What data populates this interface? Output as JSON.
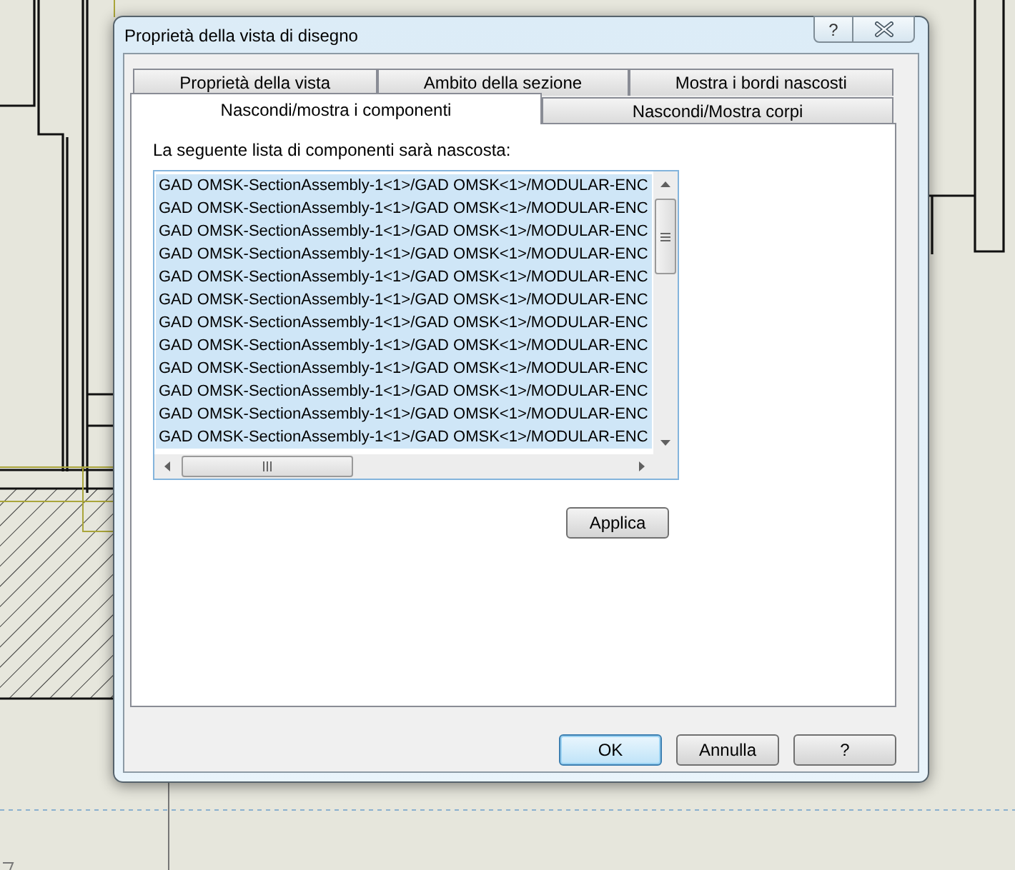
{
  "window": {
    "title": "Proprietà della vista di disegno",
    "help_button": "?"
  },
  "tab_rows": [
    {
      "tabs": [
        {
          "label": "Proprietà della vista",
          "selected": false
        },
        {
          "label": "Ambito della sezione",
          "selected": false
        },
        {
          "label": "Mostra i bordi nascosti",
          "selected": false
        }
      ]
    },
    {
      "tabs": [
        {
          "label": "Nascondi/mostra i componenti",
          "selected": true
        },
        {
          "label": "Nascondi/Mostra corpi",
          "selected": false
        }
      ]
    }
  ],
  "panel": {
    "label": "La seguente lista di componenti sarà nascosta:",
    "list": {
      "items": [
        {
          "text": "GAD OMSK-SectionAssembly-1<1>/GAD OMSK<1>/MODULAR-ENC",
          "selected": true
        },
        {
          "text": "GAD OMSK-SectionAssembly-1<1>/GAD OMSK<1>/MODULAR-ENC",
          "selected": true
        },
        {
          "text": "GAD OMSK-SectionAssembly-1<1>/GAD OMSK<1>/MODULAR-ENC",
          "selected": true
        },
        {
          "text": "GAD OMSK-SectionAssembly-1<1>/GAD OMSK<1>/MODULAR-ENC",
          "selected": true
        },
        {
          "text": "GAD OMSK-SectionAssembly-1<1>/GAD OMSK<1>/MODULAR-ENC",
          "selected": true
        },
        {
          "text": "GAD OMSK-SectionAssembly-1<1>/GAD OMSK<1>/MODULAR-ENC",
          "selected": true
        },
        {
          "text": "GAD OMSK-SectionAssembly-1<1>/GAD OMSK<1>/MODULAR-ENC",
          "selected": true
        },
        {
          "text": "GAD OMSK-SectionAssembly-1<1>/GAD OMSK<1>/MODULAR-ENC",
          "selected": true
        },
        {
          "text": "GAD OMSK-SectionAssembly-1<1>/GAD OMSK<1>/MODULAR-ENC",
          "selected": true
        },
        {
          "text": "GAD OMSK-SectionAssembly-1<1>/GAD OMSK<1>/MODULAR-ENC",
          "selected": true
        },
        {
          "text": "GAD OMSK-SectionAssembly-1<1>/GAD OMSK<1>/MODULAR-ENC",
          "selected": true
        },
        {
          "text": "GAD OMSK-SectionAssembly-1<1>/GAD OMSK<1>/MODULAR-ENC",
          "selected": true
        }
      ]
    },
    "apply_button": "Applica"
  },
  "buttons": [
    {
      "label": "OK",
      "default": true
    },
    {
      "label": "Annulla",
      "default": false
    },
    {
      "label": "?",
      "default": false
    }
  ]
}
